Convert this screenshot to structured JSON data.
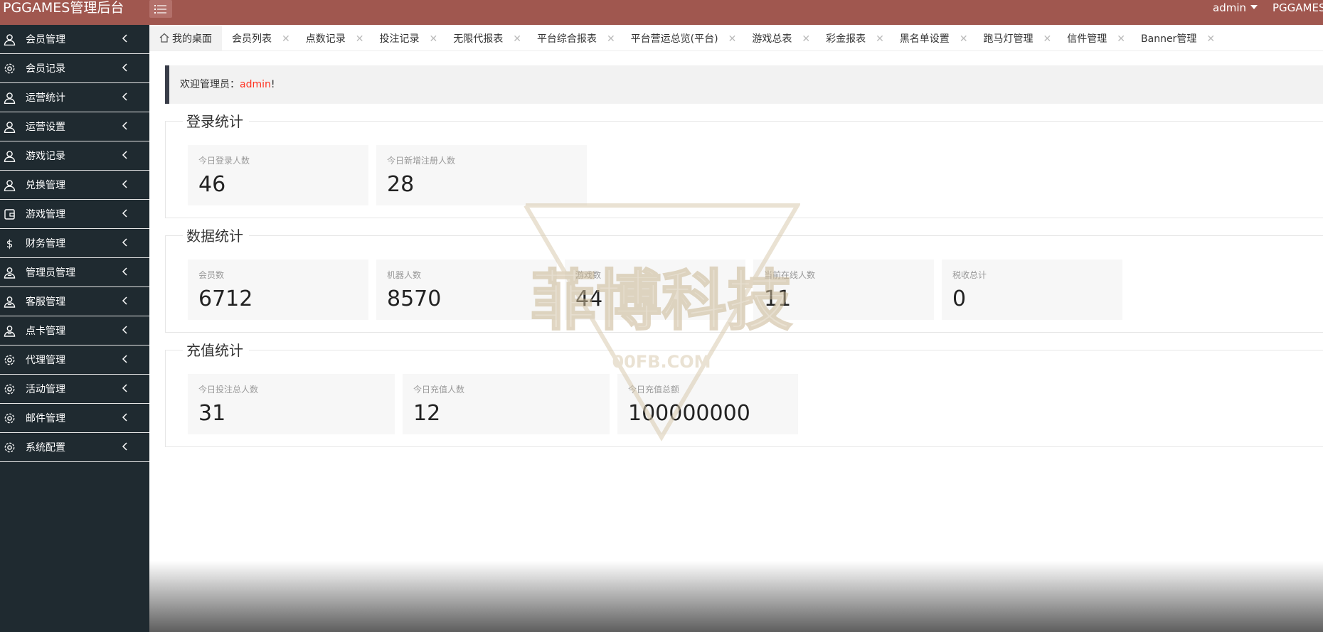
{
  "header": {
    "logo": "PGGAMES管理后台",
    "user": "admin",
    "site": "PGGAMES"
  },
  "sidebar": {
    "items": [
      {
        "label": "会员管理",
        "icon": "user-icon"
      },
      {
        "label": "会员记录",
        "icon": "gear-icon"
      },
      {
        "label": "运营统计",
        "icon": "user-icon"
      },
      {
        "label": "运营设置",
        "icon": "user-icon"
      },
      {
        "label": "游戏记录",
        "icon": "user-icon"
      },
      {
        "label": "兑换管理",
        "icon": "user-icon"
      },
      {
        "label": "游戏管理",
        "icon": "wallet-icon"
      },
      {
        "label": "财务管理",
        "icon": "dollar-icon"
      },
      {
        "label": "管理员管理",
        "icon": "user-group-icon"
      },
      {
        "label": "客服管理",
        "icon": "user-group-icon"
      },
      {
        "label": "点卡管理",
        "icon": "user-group-icon"
      },
      {
        "label": "代理管理",
        "icon": "gear-icon"
      },
      {
        "label": "活动管理",
        "icon": "gear-icon"
      },
      {
        "label": "邮件管理",
        "icon": "gear-icon"
      },
      {
        "label": "系统配置",
        "icon": "gear-icon"
      }
    ]
  },
  "tabs": [
    {
      "label": "我的桌面"
    },
    {
      "label": "会员列表"
    },
    {
      "label": "点数记录"
    },
    {
      "label": "投注记录"
    },
    {
      "label": "无限代报表"
    },
    {
      "label": "平台综合报表"
    },
    {
      "label": "平台营运总览(平台)"
    },
    {
      "label": "游戏总表"
    },
    {
      "label": "彩金报表"
    },
    {
      "label": "黑名单设置"
    },
    {
      "label": "跑马灯管理"
    },
    {
      "label": "信件管理"
    },
    {
      "label": "Banner管理"
    }
  ],
  "welcome": {
    "prefix": "欢迎管理员：",
    "name": "admin",
    "suffix": "!"
  },
  "sections": {
    "login": {
      "title": "登录统计",
      "cards": [
        {
          "label": "今日登录人数",
          "value": "46"
        },
        {
          "label": "今日新增注册人数",
          "value": "28"
        }
      ]
    },
    "data": {
      "title": "数据统计",
      "cards": [
        {
          "label": "会员数",
          "value": "6712"
        },
        {
          "label": "机器人数",
          "value": "8570"
        },
        {
          "label": "游戏数",
          "value": "44"
        },
        {
          "label": "当前在线人数",
          "value": "11"
        },
        {
          "label": "税收总计",
          "value": "0"
        }
      ]
    },
    "recharge": {
      "title": "充值统计",
      "cards": [
        {
          "label": "今日投注总人数",
          "value": "31"
        },
        {
          "label": "今日充值人数",
          "value": "12"
        },
        {
          "label": "今日充值总额",
          "value": "100000000"
        }
      ]
    }
  },
  "watermark": {
    "title": "菲博科技",
    "url": "00FB.COM"
  },
  "colors": {
    "header": "#a0574f",
    "sidebar": "#1f2a30",
    "admin_highlight": "#ff3322",
    "card_bg": "#f7f7f7"
  }
}
